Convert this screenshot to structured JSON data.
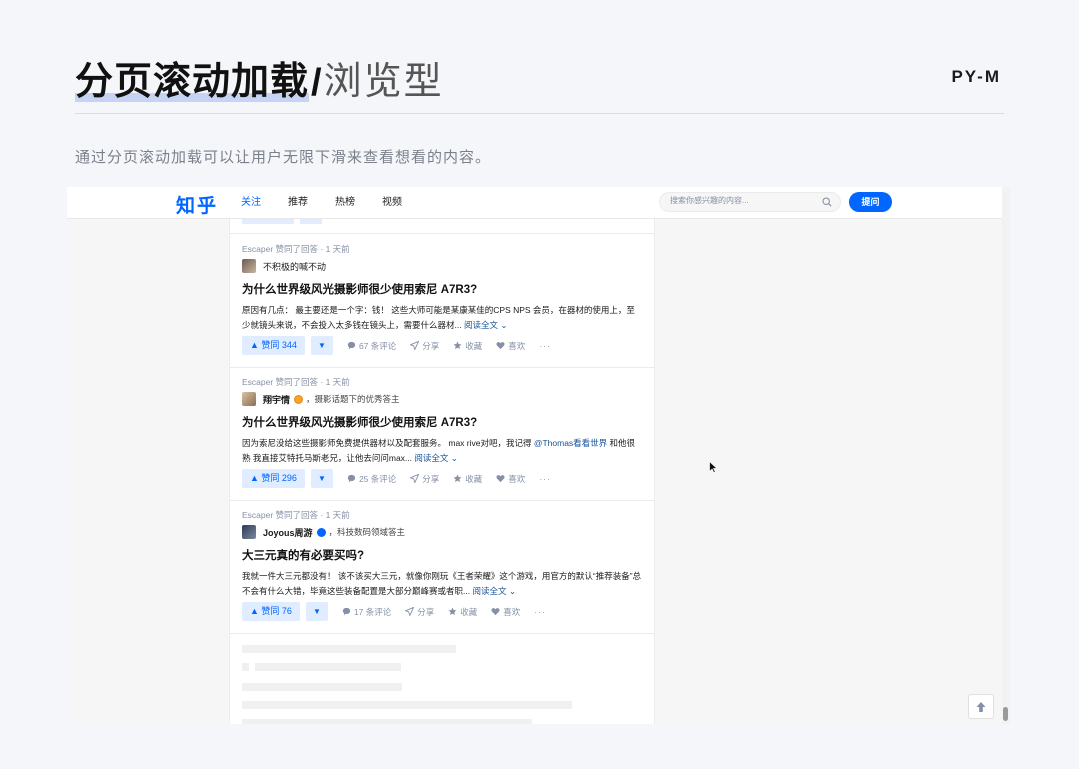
{
  "slide": {
    "title_bold": "分页滚动加载",
    "title_sep": "/",
    "title_light": "浏览型",
    "brand": "PY-M",
    "description": "通过分页滚动加载可以让用户无限下滑来查看想看的内容。"
  },
  "nav": {
    "logo": "知乎",
    "tabs": [
      {
        "label": "关注",
        "active": true
      },
      {
        "label": "推荐",
        "active": false
      },
      {
        "label": "热榜",
        "active": false
      },
      {
        "label": "视频",
        "active": false
      }
    ],
    "search_placeholder": "搜索你感兴趣的内容...",
    "ask_label": "提问"
  },
  "feed": [
    {
      "meta": "Escaper 赞同了回答 · 1 天前",
      "author": "不积极的喊不动",
      "author_desc": "",
      "title": "为什么世界级风光摄影师很少使用索尼 A7R3?",
      "excerpt": "原因有几点： 最主要还是一个字：钱！ 这些大师可能是某康某佳的CPS NPS 会员，在器材的使用上，至少就镜头来说，不会投入太多钱在镜头上，需要什么器材...",
      "read_more": "阅读全文 ⌄",
      "vote": "▲ 赞同 344",
      "comments": "67 条评论",
      "share": "分享",
      "collect": "收藏",
      "like": "喜欢",
      "more": "···"
    },
    {
      "meta": "Escaper 赞同了回答 · 1 天前",
      "author": "翔宇情",
      "author_desc": "，摄影话题下的优秀答主",
      "title": "为什么世界级风光摄影师很少使用索尼 A7R3?",
      "excerpt_before": "因为索尼没给这些摄影师免费提供器材以及配套服务。 max rive对吧，我记得 ",
      "mention": "@Thomas看看世界",
      "excerpt_after": " 和他很熟 我直接艾特托马斯老兄，让他去问问max...",
      "read_more": "阅读全文 ⌄",
      "vote": "▲ 赞同 296",
      "comments": "25 条评论",
      "share": "分享",
      "collect": "收藏",
      "like": "喜欢",
      "more": "···"
    },
    {
      "meta": "Escaper 赞同了回答 · 1 天前",
      "author": "Joyous周游",
      "author_desc": "，科技数码领域答主",
      "title": "大三元真的有必要买吗?",
      "excerpt": "我就一件大三元都没有！ 该不该买大三元，就像你刚玩《王者荣耀》这个游戏，用官方的默认“推荐装备”总不会有什么大错，毕竟这些装备配置是大部分巅峰赛或者职...",
      "read_more": "阅读全文 ⌄",
      "vote": "▲ 赞同 76",
      "comments": "17 条评论",
      "share": "分享",
      "collect": "收藏",
      "like": "喜欢",
      "more": "···"
    }
  ],
  "icons": {
    "vote_down": "▼",
    "back_to_top": "arrow-up-icon"
  },
  "colors": {
    "brand_blue": "#0066ff",
    "vote_bg": "#e0ecff",
    "link": "#175199",
    "meta_gray": "#8590a6",
    "title_highlight": "#c7d3f5"
  }
}
